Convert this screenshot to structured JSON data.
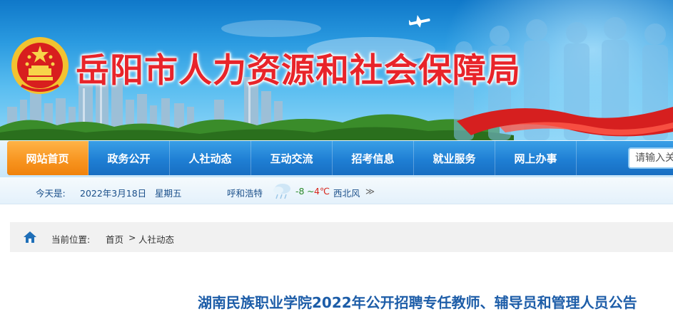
{
  "header": {
    "site_title": "岳阳市人力资源和社会保障局"
  },
  "nav": {
    "items": [
      {
        "label": "网站首页",
        "active": true
      },
      {
        "label": "政务公开",
        "active": false
      },
      {
        "label": "人社动态",
        "active": false
      },
      {
        "label": "互动交流",
        "active": false
      },
      {
        "label": "招考信息",
        "active": false
      },
      {
        "label": "就业服务",
        "active": false
      },
      {
        "label": "网上办事",
        "active": false
      }
    ],
    "search_placeholder": "请输入关键字"
  },
  "info": {
    "today_label": "今天是:",
    "date": "2022年3月18日",
    "weekday": "星期五",
    "city": "呼和浩特",
    "temp_low": "-8",
    "temp_sep": "~",
    "temp_high": "4℃",
    "wind": "西北风",
    "more": "≫"
  },
  "breadcrumb": {
    "label": "当前位置:",
    "items": [
      "首页",
      "人社动态"
    ],
    "separator": ">"
  },
  "article": {
    "title": "湖南民族职业学院2022年公开招聘专任教师、辅导员和管理人员公告"
  },
  "colors": {
    "title_red": "#e8242a",
    "nav_blue": "#1f7fd4",
    "nav_active_orange": "#f7931e",
    "article_title_blue": "#1d5da8"
  },
  "icons": {
    "emblem": "national-emblem-icon",
    "plane": "airplane-icon",
    "weather": "weather-icon",
    "home": "home-icon"
  }
}
